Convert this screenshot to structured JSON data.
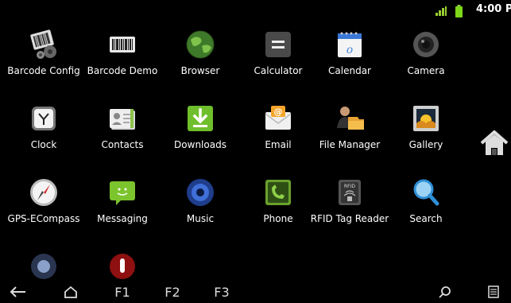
{
  "status": {
    "time": "4:00 PM"
  },
  "apps": [
    {
      "label": "Barcode Config",
      "icon": "barcode-config-icon"
    },
    {
      "label": "Barcode Demo",
      "icon": "barcode-demo-icon"
    },
    {
      "label": "Browser",
      "icon": "browser-globe-icon"
    },
    {
      "label": "Calculator",
      "icon": "calculator-icon"
    },
    {
      "label": "Calendar",
      "icon": "calendar-icon"
    },
    {
      "label": "Camera",
      "icon": "camera-icon"
    },
    {
      "label": "Clock",
      "icon": "clock-icon"
    },
    {
      "label": "Contacts",
      "icon": "contacts-icon"
    },
    {
      "label": "Downloads",
      "icon": "downloads-icon"
    },
    {
      "label": "Email",
      "icon": "email-icon"
    },
    {
      "label": "File Manager",
      "icon": "file-manager-icon"
    },
    {
      "label": "Gallery",
      "icon": "gallery-icon"
    },
    {
      "label": "GPS-ECompass",
      "icon": "compass-icon"
    },
    {
      "label": "Messaging",
      "icon": "messaging-icon"
    },
    {
      "label": "Music",
      "icon": "music-icon"
    },
    {
      "label": "Phone",
      "icon": "phone-icon"
    },
    {
      "label": "RFID Tag Reader",
      "icon": "rfid-reader-icon"
    },
    {
      "label": "Search",
      "icon": "search-icon"
    },
    {
      "label": "",
      "icon": "settings-icon"
    },
    {
      "label": "",
      "icon": "voice-recorder-icon"
    }
  ],
  "nav": {
    "f1": "F1",
    "f2": "F2",
    "f3": "F3"
  }
}
